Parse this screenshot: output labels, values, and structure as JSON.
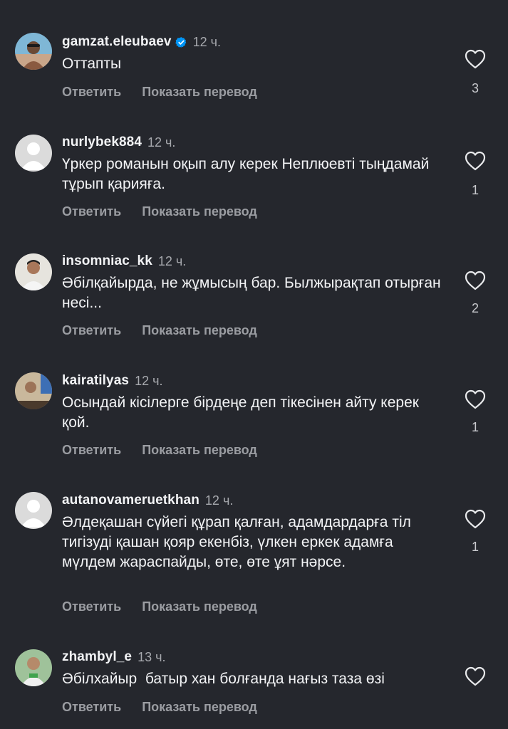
{
  "actions": {
    "reply": "Ответить",
    "translate": "Показать перевод"
  },
  "colors": {
    "background": "#25272d",
    "text": "#f2f3f5",
    "muted": "#9b9da2",
    "verified": "#0095f6"
  },
  "comments": [
    {
      "username": "gamzat.eleubaev",
      "verified": true,
      "time": "12 ч.",
      "text": "Оттапты",
      "likes": "3",
      "avatar": "photo-avatar",
      "like_icon": "heart-outline-icon"
    },
    {
      "username": "nurlybek884",
      "verified": false,
      "time": "12 ч.",
      "text": "Үркер романын оқып алу керек Неплюевті тыңдамай тұрып қарияға.",
      "likes": "1",
      "avatar": "default-avatar",
      "like_icon": "heart-outline-icon"
    },
    {
      "username": "insomniac_kk",
      "verified": false,
      "time": "12 ч.",
      "text": "Әбілқайырда, не жұмысың бар. Былжырақтап отырған несі...",
      "likes": "2",
      "avatar": "photo-avatar",
      "like_icon": "heart-outline-icon"
    },
    {
      "username": "kairatilyas",
      "verified": false,
      "time": "12 ч.",
      "text": "Осындай кісілерге бірдеңе деп тікесінен айту керек қой.",
      "likes": "1",
      "avatar": "photo-avatar",
      "like_icon": "heart-outline-icon"
    },
    {
      "username": "autanovameruetkhan",
      "verified": false,
      "time": "12 ч.",
      "text": "Әлдеқашан сүйегі құрап қалған, адамдардарға тіл тигізуді қашан қояр екенбіз, үлкен еркек адамға мүлдем жараспайды, өте, өте ұят нәрсе.",
      "likes": "1",
      "avatar": "default-avatar",
      "like_icon": "heart-outline-icon"
    },
    {
      "username": "zhambyl_e",
      "verified": false,
      "time": "13 ч.",
      "text": "Әбілхайыр  батыр хан болғанда нағыз таза өзі",
      "likes": "",
      "avatar": "photo-avatar",
      "like_icon": "heart-outline-icon"
    }
  ]
}
